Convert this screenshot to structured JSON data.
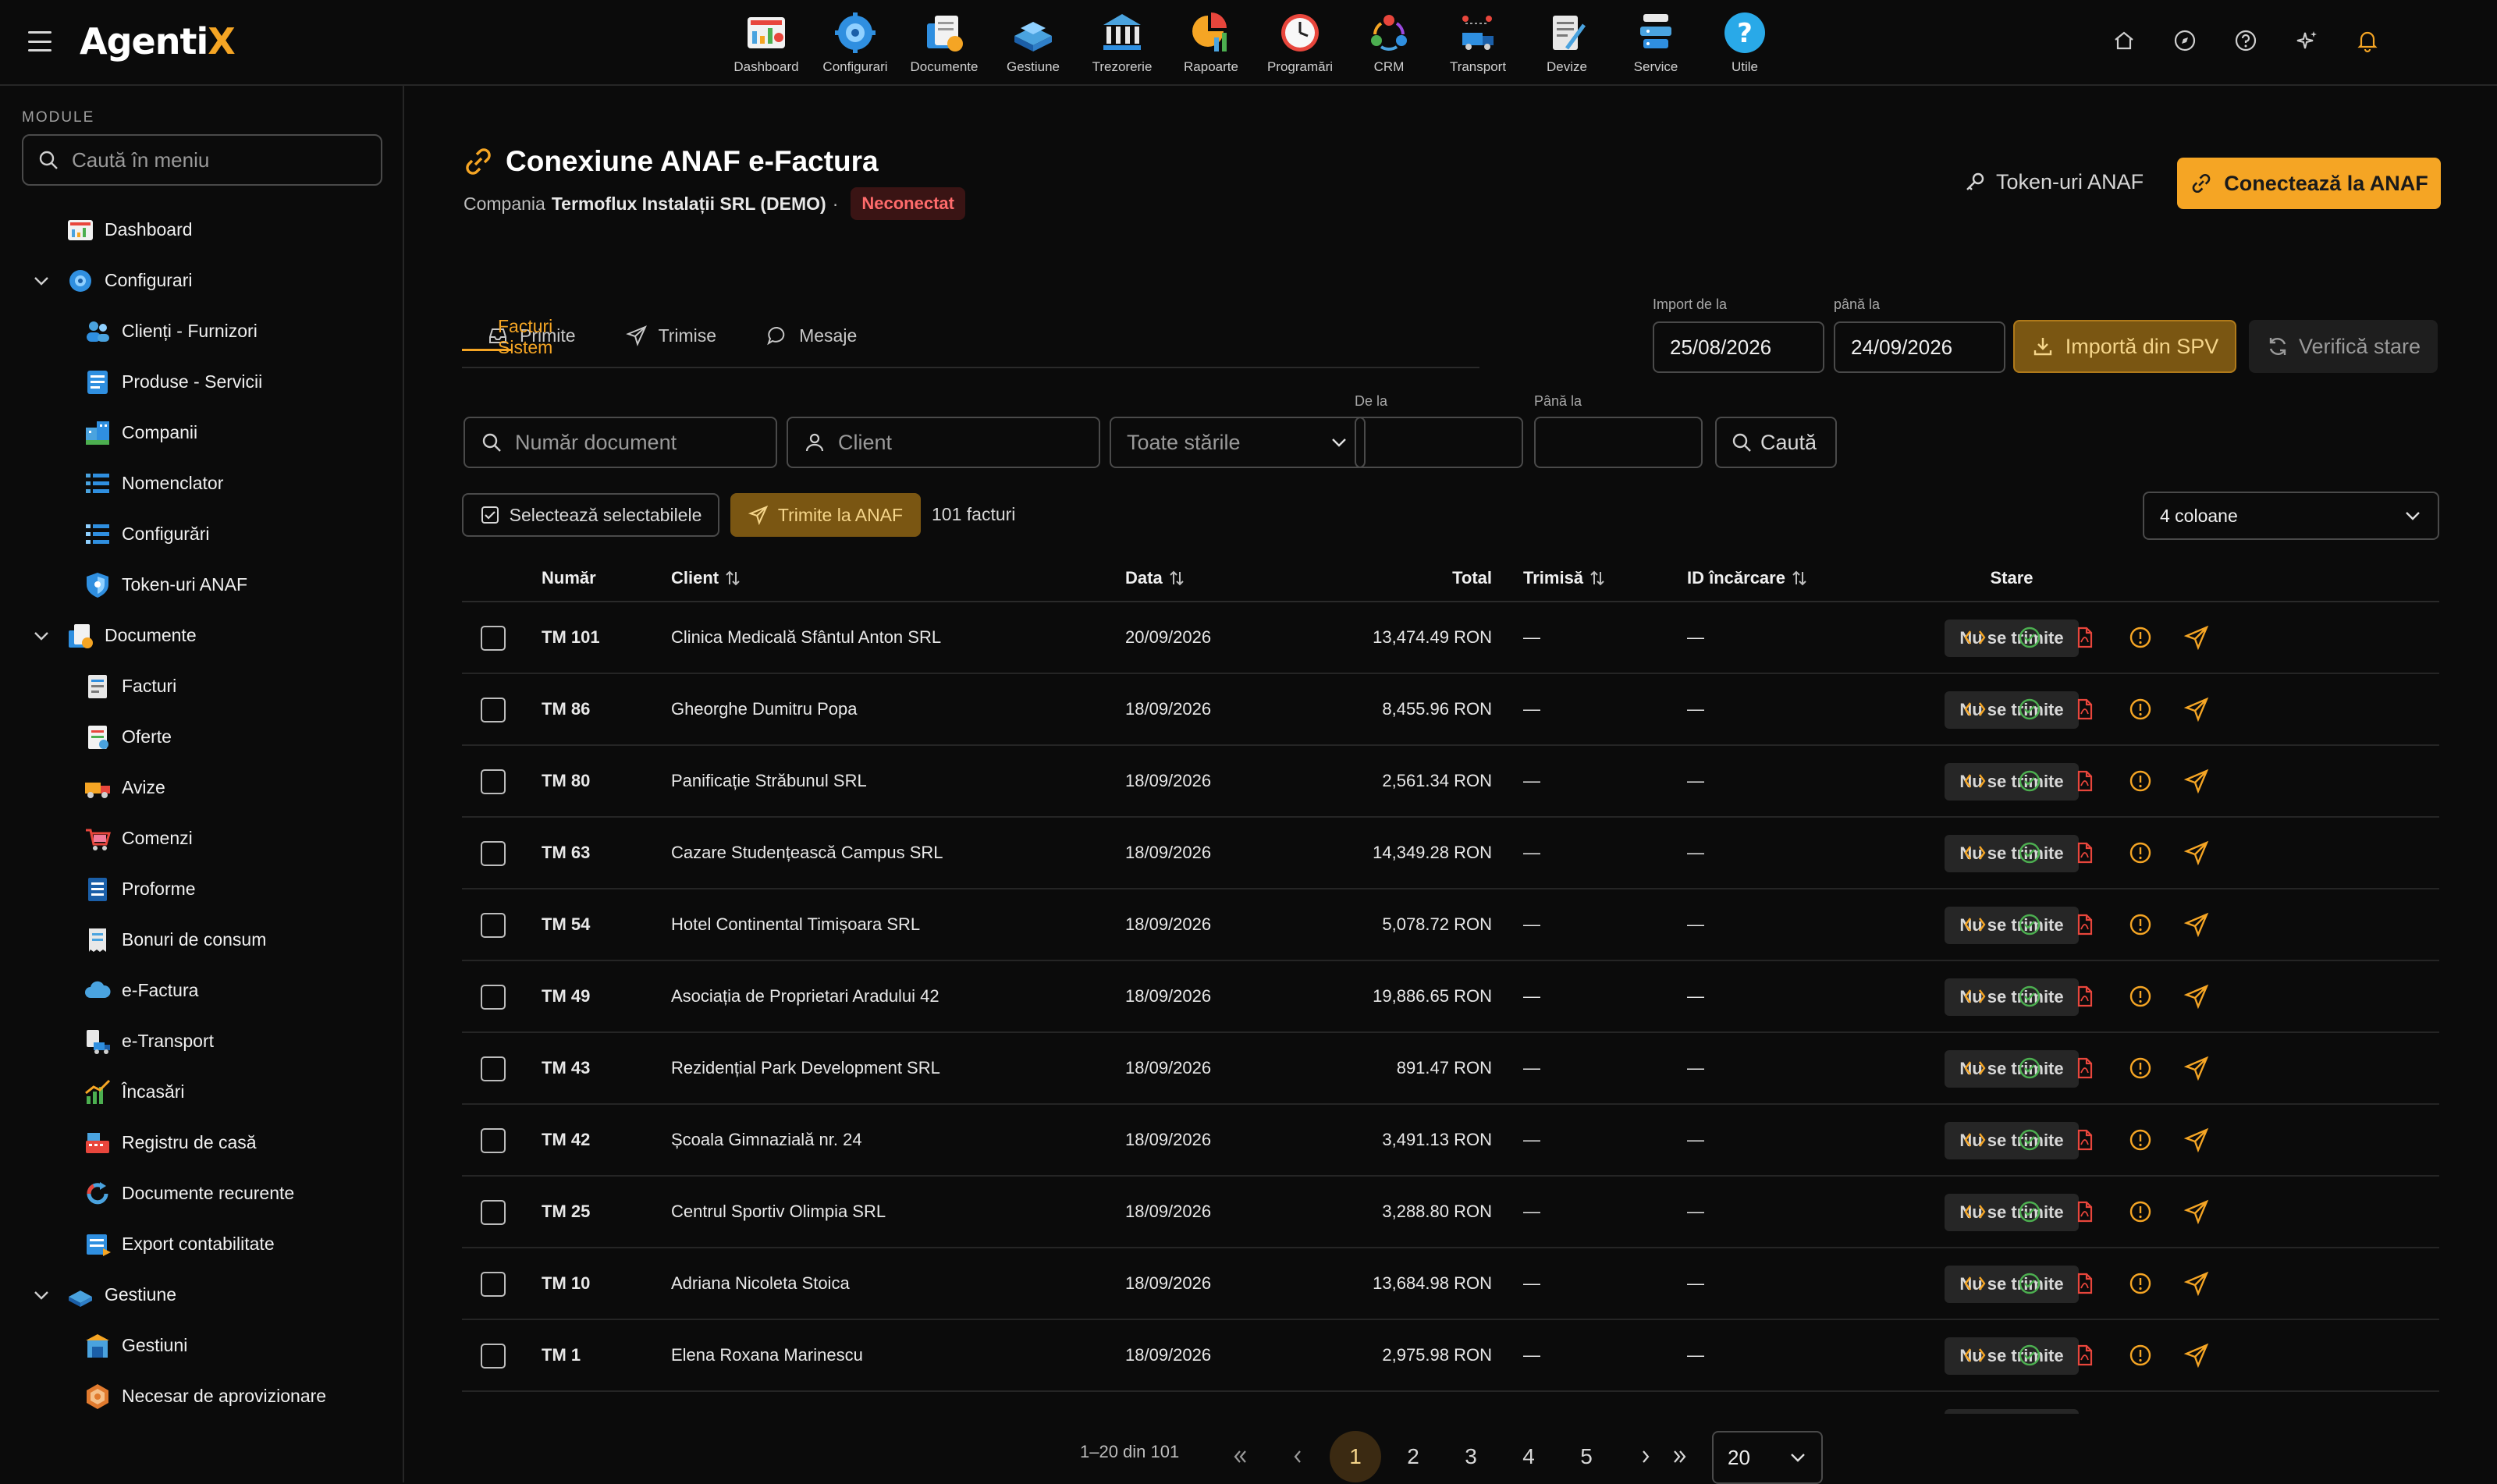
{
  "app": {
    "brand_main": "Agenti",
    "brand_accent": "X"
  },
  "topnav": [
    {
      "label": "Dashboard",
      "icon": "dashboard-icon"
    },
    {
      "label": "Configurari",
      "icon": "configurari-icon"
    },
    {
      "label": "Documente",
      "icon": "documente-icon"
    },
    {
      "label": "Gestiune",
      "icon": "gestiune-icon"
    },
    {
      "label": "Trezorerie",
      "icon": "trezorerie-icon"
    },
    {
      "label": "Rapoarte",
      "icon": "rapoarte-icon"
    },
    {
      "label": "Programări",
      "icon": "programari-icon"
    },
    {
      "label": "CRM",
      "icon": "crm-icon"
    },
    {
      "label": "Transport",
      "icon": "transport-icon"
    },
    {
      "label": "Devize",
      "icon": "devize-icon"
    },
    {
      "label": "Service",
      "icon": "service-icon"
    },
    {
      "label": "Utile",
      "icon": "utile-icon"
    }
  ],
  "sidebar": {
    "title": "MODULE",
    "search_placeholder": "Caută în meniu",
    "items": [
      {
        "label": "Dashboard",
        "level": 1,
        "expandable": false
      },
      {
        "label": "Configurari",
        "level": 1,
        "expandable": true
      },
      {
        "label": "Clienți - Furnizori",
        "level": 2
      },
      {
        "label": "Produse - Servicii",
        "level": 2
      },
      {
        "label": "Companii",
        "level": 2
      },
      {
        "label": "Nomenclator",
        "level": 2
      },
      {
        "label": "Configurări",
        "level": 2
      },
      {
        "label": "Token-uri ANAF",
        "level": 2
      },
      {
        "label": "Documente",
        "level": 1,
        "expandable": true
      },
      {
        "label": "Facturi",
        "level": 2
      },
      {
        "label": "Oferte",
        "level": 2
      },
      {
        "label": "Avize",
        "level": 2
      },
      {
        "label": "Comenzi",
        "level": 2
      },
      {
        "label": "Proforme",
        "level": 2
      },
      {
        "label": "Bonuri de consum",
        "level": 2
      },
      {
        "label": "e-Factura",
        "level": 2
      },
      {
        "label": "e-Transport",
        "level": 2
      },
      {
        "label": "Încasări",
        "level": 2
      },
      {
        "label": "Registru de casă",
        "level": 2
      },
      {
        "label": "Documente recurente",
        "level": 2
      },
      {
        "label": "Export contabilitate",
        "level": 2
      },
      {
        "label": "Gestiune",
        "level": 1,
        "expandable": true
      },
      {
        "label": "Gestiuni",
        "level": 2
      },
      {
        "label": "Necesar de aprovizionare",
        "level": 2
      }
    ]
  },
  "page": {
    "title": "Conexiune ANAF e-Factura",
    "company_prefix": "Compania",
    "company_name": "Termoflux Instalații SRL (DEMO)",
    "separator": "·",
    "status": "Neconectat",
    "token_button": "Token-uri ANAF",
    "connect_button": "Conectează la ANAF"
  },
  "tabs": [
    {
      "label": "Primite",
      "active": false
    },
    {
      "label": "Trimise",
      "active": false
    },
    {
      "label": "Mesaje",
      "active": false
    },
    {
      "label": "Facturi Sistem",
      "active": true
    }
  ],
  "import": {
    "from_label": "Import de la",
    "from_value": "25/08/2026",
    "to_label": "până la",
    "to_value": "24/09/2026",
    "import_button": "Importă din SPV",
    "verify_button": "Verifică stare"
  },
  "filters": {
    "doc_placeholder": "Număr document",
    "client_placeholder": "Client",
    "status_value": "Toate stările",
    "from_label": "De la",
    "to_label": "Până la",
    "search_button": "Caută"
  },
  "actions": {
    "select_button": "Selectează selectabilele",
    "send_button": "Trimite la ANAF",
    "count": "101 facturi",
    "columns_value": "4 coloane"
  },
  "table": {
    "headers": {
      "number": "Număr",
      "client": "Client",
      "date": "Data",
      "total": "Total",
      "sent": "Trimisă",
      "upload_id": "ID încărcare",
      "status": "Stare"
    },
    "rows": [
      {
        "number": "TM 101",
        "client": "Clinica Medicală Sfântul Anton SRL",
        "date": "20/09/2026",
        "total": "13,474.49 RON",
        "sent": "—",
        "upload_id": "—",
        "status": "Nu se trimite"
      },
      {
        "number": "TM 86",
        "client": "Gheorghe Dumitru Popa",
        "date": "18/09/2026",
        "total": "8,455.96 RON",
        "sent": "—",
        "upload_id": "—",
        "status": "Nu se trimite"
      },
      {
        "number": "TM 80",
        "client": "Panificație Străbunul SRL",
        "date": "18/09/2026",
        "total": "2,561.34 RON",
        "sent": "—",
        "upload_id": "—",
        "status": "Nu se trimite"
      },
      {
        "number": "TM 63",
        "client": "Cazare Studențească Campus SRL",
        "date": "18/09/2026",
        "total": "14,349.28 RON",
        "sent": "—",
        "upload_id": "—",
        "status": "Nu se trimite"
      },
      {
        "number": "TM 54",
        "client": "Hotel Continental Timișoara SRL",
        "date": "18/09/2026",
        "total": "5,078.72 RON",
        "sent": "—",
        "upload_id": "—",
        "status": "Nu se trimite"
      },
      {
        "number": "TM 49",
        "client": "Asociația de Proprietari Aradului 42",
        "date": "18/09/2026",
        "total": "19,886.65 RON",
        "sent": "—",
        "upload_id": "—",
        "status": "Nu se trimite"
      },
      {
        "number": "TM 43",
        "client": "Rezidențial Park Development SRL",
        "date": "18/09/2026",
        "total": "891.47 RON",
        "sent": "—",
        "upload_id": "—",
        "status": "Nu se trimite"
      },
      {
        "number": "TM 42",
        "client": "Școala Gimnazială nr. 24",
        "date": "18/09/2026",
        "total": "3,491.13 RON",
        "sent": "—",
        "upload_id": "—",
        "status": "Nu se trimite"
      },
      {
        "number": "TM 25",
        "client": "Centrul Sportiv Olimpia SRL",
        "date": "18/09/2026",
        "total": "3,288.80 RON",
        "sent": "—",
        "upload_id": "—",
        "status": "Nu se trimite"
      },
      {
        "number": "TM 10",
        "client": "Adriana Nicoleta Stoica",
        "date": "18/09/2026",
        "total": "13,684.98 RON",
        "sent": "—",
        "upload_id": "—",
        "status": "Nu se trimite"
      },
      {
        "number": "TM 1",
        "client": "Elena Roxana Marinescu",
        "date": "18/09/2026",
        "total": "2,975.98 RON",
        "sent": "—",
        "upload_id": "—",
        "status": "Nu se trimite"
      }
    ]
  },
  "pagination": {
    "info": "1–20 din 101",
    "pages": [
      "1",
      "2",
      "3",
      "4",
      "5"
    ],
    "current": "1",
    "page_size": "20"
  },
  "colors": {
    "accent": "#f5a524",
    "background": "#0b0b0b",
    "danger": "#ff6b6b",
    "success": "#4caf50"
  }
}
